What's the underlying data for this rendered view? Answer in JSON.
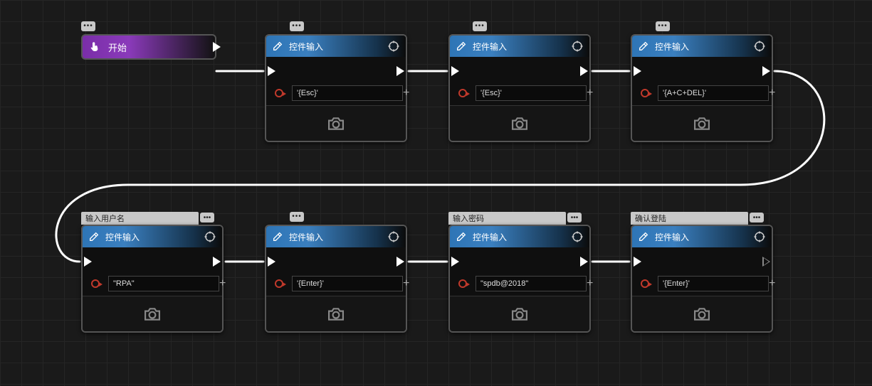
{
  "start": {
    "label": "开始"
  },
  "nodes": {
    "n1": {
      "title": "控件输入",
      "value": "'{Esc}'"
    },
    "n2": {
      "title": "控件输入",
      "value": "'{Esc}'"
    },
    "n3": {
      "title": "控件输入",
      "value": "'{A+C+DEL}'"
    },
    "n4": {
      "title": "控件输入",
      "value": "\"RPA\"",
      "tag": "输入用户名"
    },
    "n5": {
      "title": "控件输入",
      "value": "'{Enter}'"
    },
    "n6": {
      "title": "控件输入",
      "value": "\"spdb@2018\"",
      "tag": "输入密码"
    },
    "n7": {
      "title": "控件输入",
      "value": "'{Enter}'",
      "tag": "确认登陆"
    }
  }
}
